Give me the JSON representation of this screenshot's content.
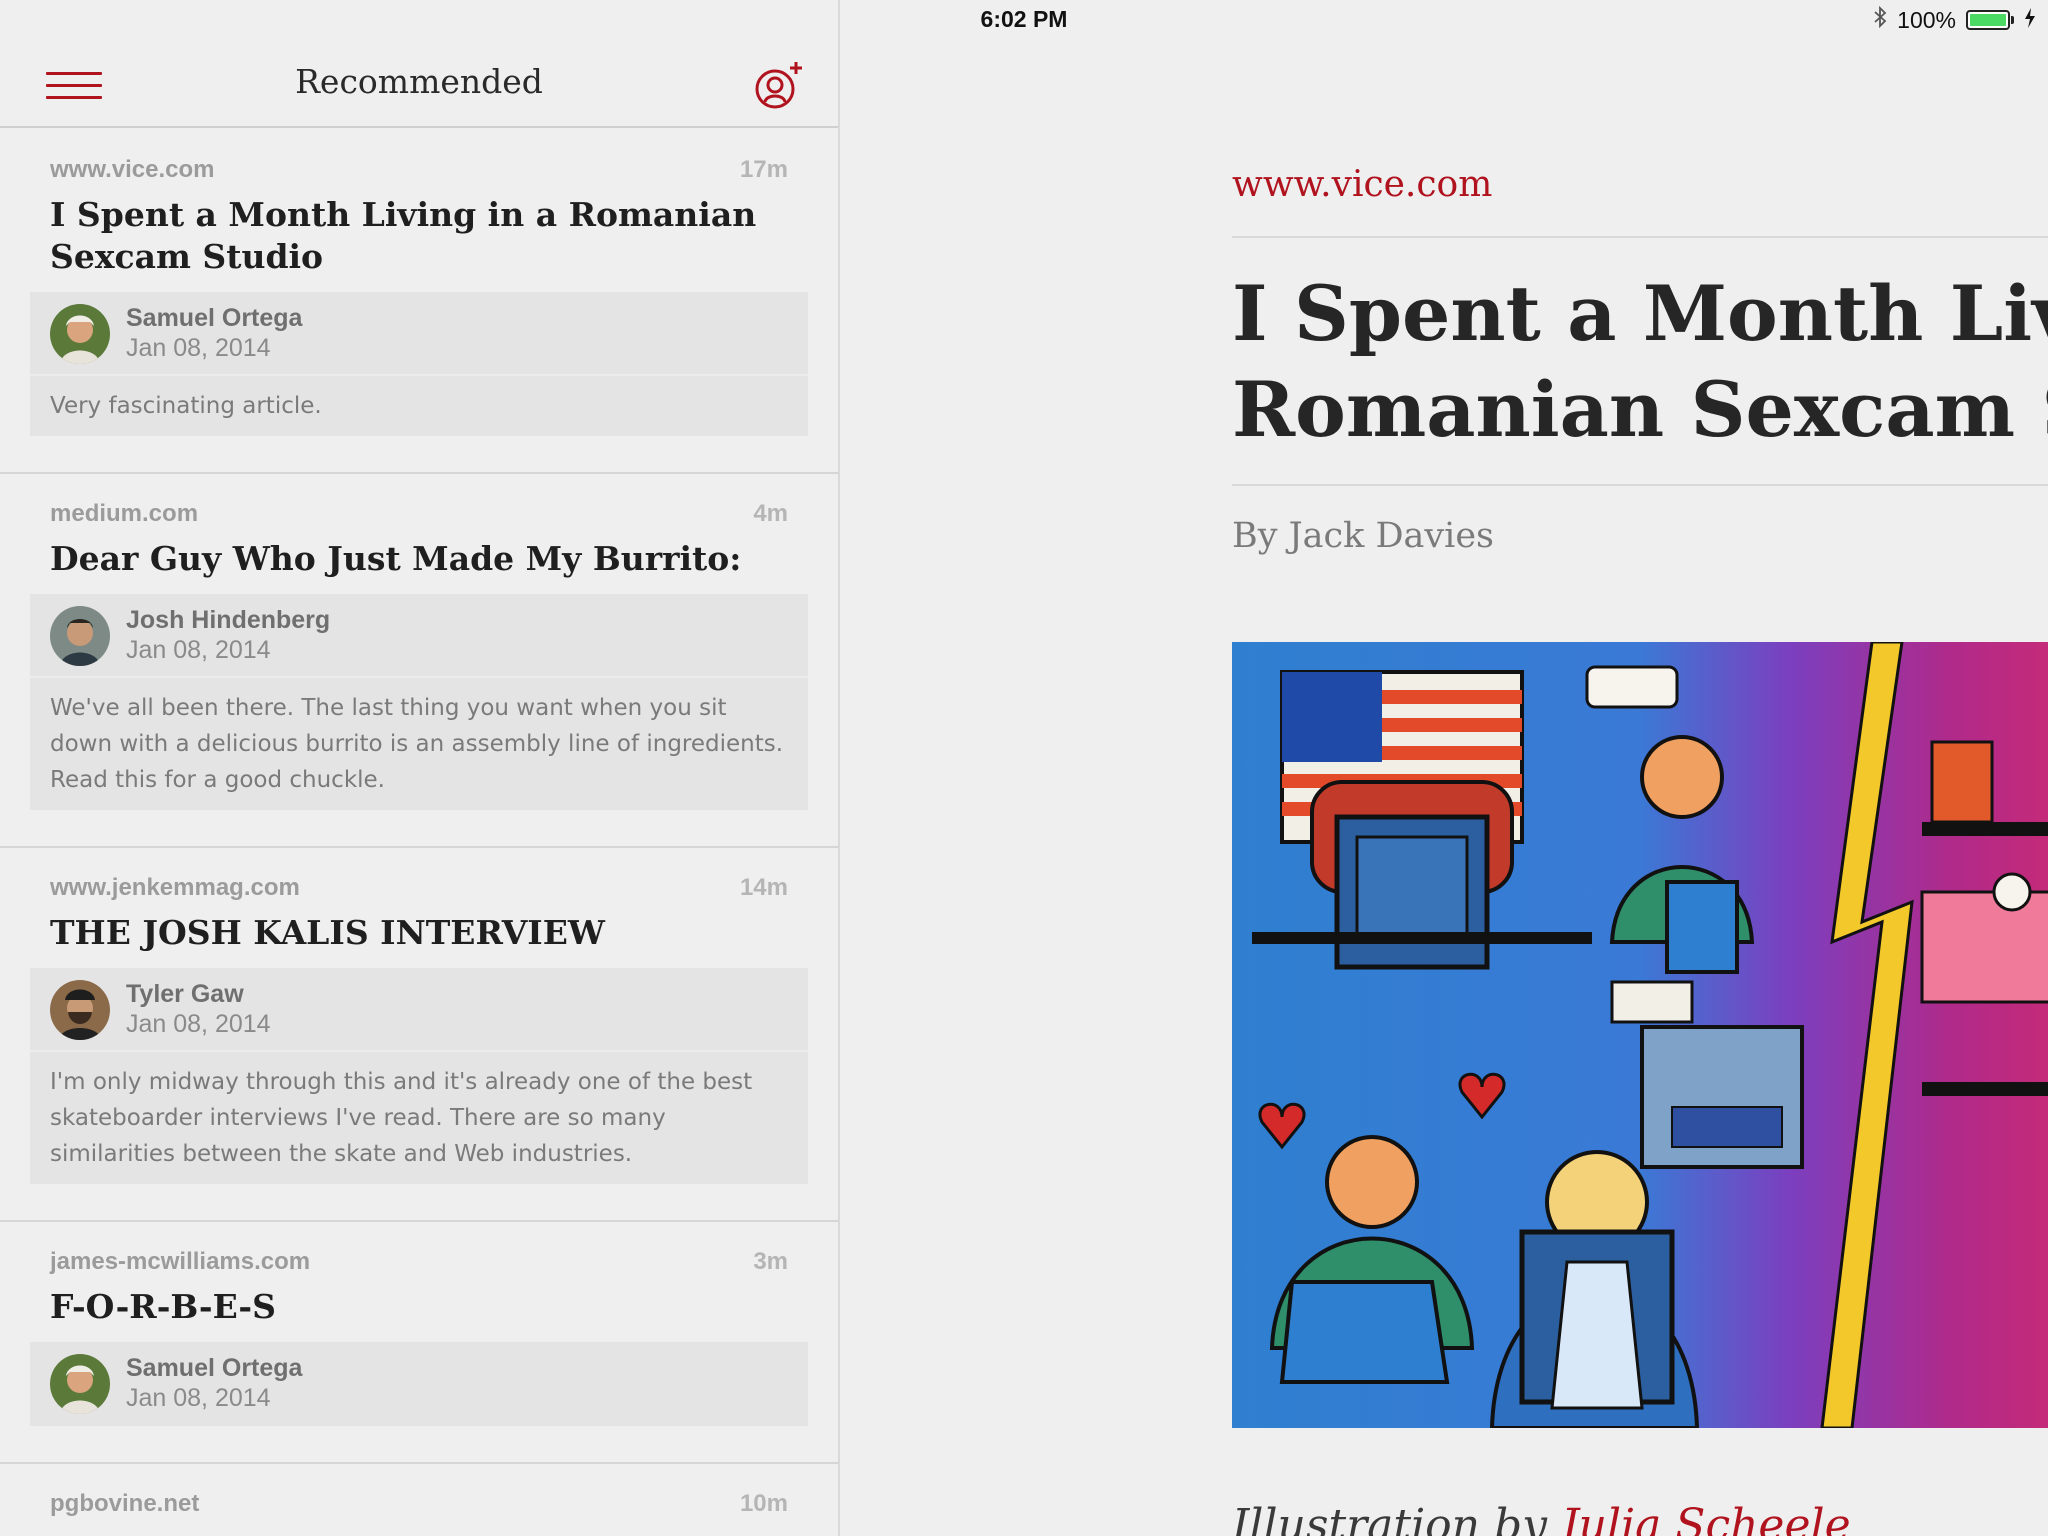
{
  "status_bar": {
    "device": "iPad",
    "time": "6:02 PM",
    "battery": "100%"
  },
  "nav": {
    "title": "Recommended"
  },
  "feed": [
    {
      "domain": "www.vice.com",
      "time": "17m",
      "title": "I Spent a Month Living in a Romanian Sexcam Studio",
      "user": "Samuel Ortega",
      "date": "Jan 08, 2014",
      "comment": "Very fascinating article."
    },
    {
      "domain": "medium.com",
      "time": "4m",
      "title": "Dear Guy Who Just Made My Burrito:",
      "user": "Josh Hindenberg",
      "date": "Jan 08, 2014",
      "comment": "We've all been there. The last thing you want when you sit down with a delicious burrito is an assembly line of ingredients. Read this for a good chuckle."
    },
    {
      "domain": "www.jenkemmag.com",
      "time": "14m",
      "title": "THE JOSH KALIS INTERVIEW",
      "user": "Tyler Gaw",
      "date": "Jan 08, 2014",
      "comment": "I'm only midway through this and it's already one of the best skateboarder interviews I've read. There are so many similarities between the skate and Web industries."
    },
    {
      "domain": "james-mcwilliams.com",
      "time": "3m",
      "title": "F-O-R-B-E-S",
      "user": "Samuel Ortega",
      "date": "Jan 08, 2014",
      "comment": ""
    },
    {
      "domain": "pgbovine.net",
      "time": "10m",
      "title": "",
      "user": "",
      "date": "",
      "comment": ""
    }
  ],
  "article": {
    "domain": "www.vice.com",
    "title_line1": "I Spent a Month Livin",
    "title_line2": "Romanian Sexcam St",
    "byline": "By Jack Davies",
    "caption_prefix": "Illustration by ",
    "caption_link": "Julia Scheele"
  },
  "colors": {
    "accent": "#b0131e",
    "background": "#efefef",
    "battery": "#4cd964"
  }
}
